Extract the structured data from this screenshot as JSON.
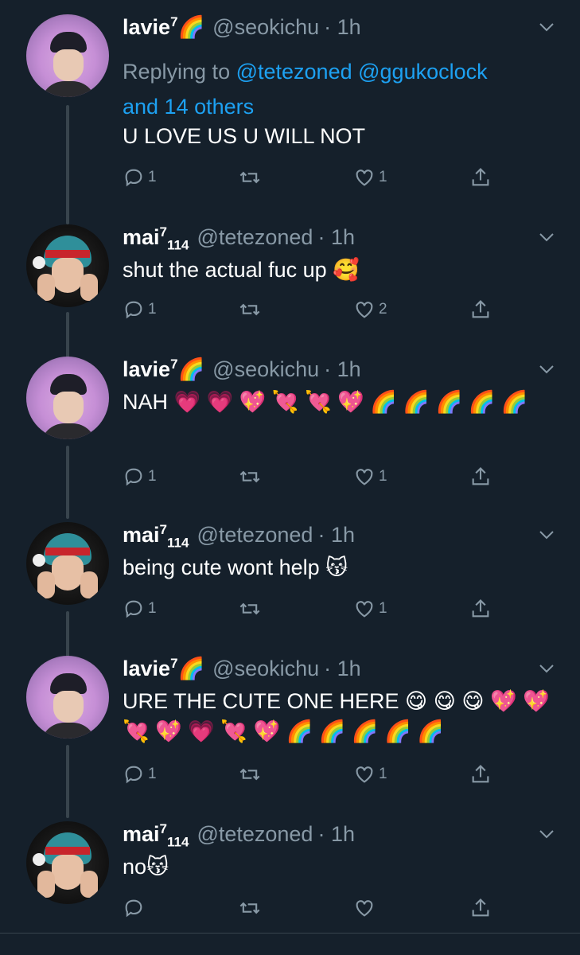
{
  "tweets": [
    {
      "name": "lavie",
      "name_sup": "7",
      "name_sub": "",
      "badge_emoji": "🌈",
      "handle": "@seokichu",
      "time": "· 1h",
      "replying": {
        "prefix": "Replying to ",
        "mentions": [
          "@tetezoned",
          "@ggukoclock"
        ],
        "suffix": "and 14 others"
      },
      "text": "U LOVE US U WILL NOT",
      "replies": "1",
      "retweets": "",
      "likes": "1"
    },
    {
      "name": "mai",
      "name_sup": "7",
      "name_sub": "114",
      "badge_emoji": "",
      "handle": "@tetezoned",
      "time": "· 1h",
      "text": "shut the actual fuc up 🥰",
      "replies": "1",
      "retweets": "",
      "likes": "2"
    },
    {
      "name": "lavie",
      "name_sup": "7",
      "name_sub": "",
      "badge_emoji": "🌈",
      "handle": "@seokichu",
      "time": "· 1h",
      "text": "NAH 💗 💗 💖 💘 💘 💖 🌈 🌈 🌈 🌈 🌈",
      "replies": "1",
      "retweets": "",
      "likes": "1"
    },
    {
      "name": "mai",
      "name_sup": "7",
      "name_sub": "114",
      "badge_emoji": "",
      "handle": "@tetezoned",
      "time": "· 1h",
      "text": "being cute wont help 😽",
      "replies": "1",
      "retweets": "",
      "likes": "1"
    },
    {
      "name": "lavie",
      "name_sup": "7",
      "name_sub": "",
      "badge_emoji": "🌈",
      "handle": "@seokichu",
      "time": "· 1h",
      "text": "URE THE CUTE ONE HERE 😋 😋 😋 💖 💖 💘 💖 💗 💘 💖 🌈 🌈 🌈 🌈 🌈",
      "replies": "1",
      "retweets": "",
      "likes": "1"
    },
    {
      "name": "mai",
      "name_sup": "7",
      "name_sub": "114",
      "badge_emoji": "",
      "handle": "@tetezoned",
      "time": "· 1h",
      "text": "no😽",
      "replies": "",
      "retweets": "",
      "likes": ""
    }
  ],
  "colors": {
    "background": "#15202b",
    "text": "#ffffff",
    "secondary": "#8899a6",
    "link": "#1da1f2",
    "thread_line": "#38444d"
  }
}
